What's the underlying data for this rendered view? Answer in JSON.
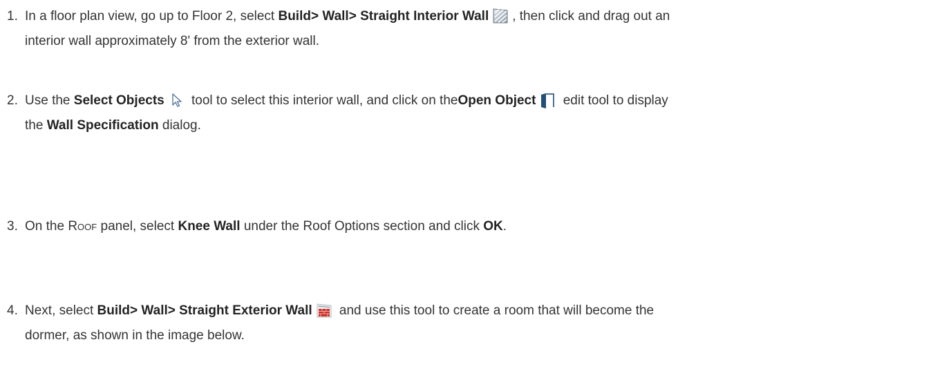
{
  "steps": [
    {
      "number": "1.",
      "t1": "In a floor plan view, go up to Floor 2, select ",
      "b1": "Build> Wall> Straight Interior Wall",
      "t2": ", then click and drag out an",
      "t3": "interior wall approximately 8' from the exterior wall.",
      "icon": "interior-wall-icon"
    },
    {
      "number": "2.",
      "t1": "Use the ",
      "b1": "Select Objects",
      "t2": " tool to select this interior wall, and click on the",
      "b2": "Open Object",
      "t3": " edit tool to display",
      "t4": "the ",
      "b3": "Wall Specification",
      "t5": " dialog.",
      "icons": [
        "select-arrow-icon",
        "open-object-icon"
      ]
    },
    {
      "number": "3.",
      "t1": "On the ",
      "sc": "Roof",
      "t2": " panel, select ",
      "b1": "Knee Wall",
      "t3": " under the Roof Options section and click ",
      "b2": "OK",
      "t4": "."
    },
    {
      "number": "4.",
      "t1": "Next, select ",
      "b1": "Build> Wall> Straight Exterior Wall",
      "t2": " and use this tool to create a room that will become the",
      "t3": "dormer, as shown in the image below.",
      "icon": "exterior-wall-icon"
    }
  ]
}
